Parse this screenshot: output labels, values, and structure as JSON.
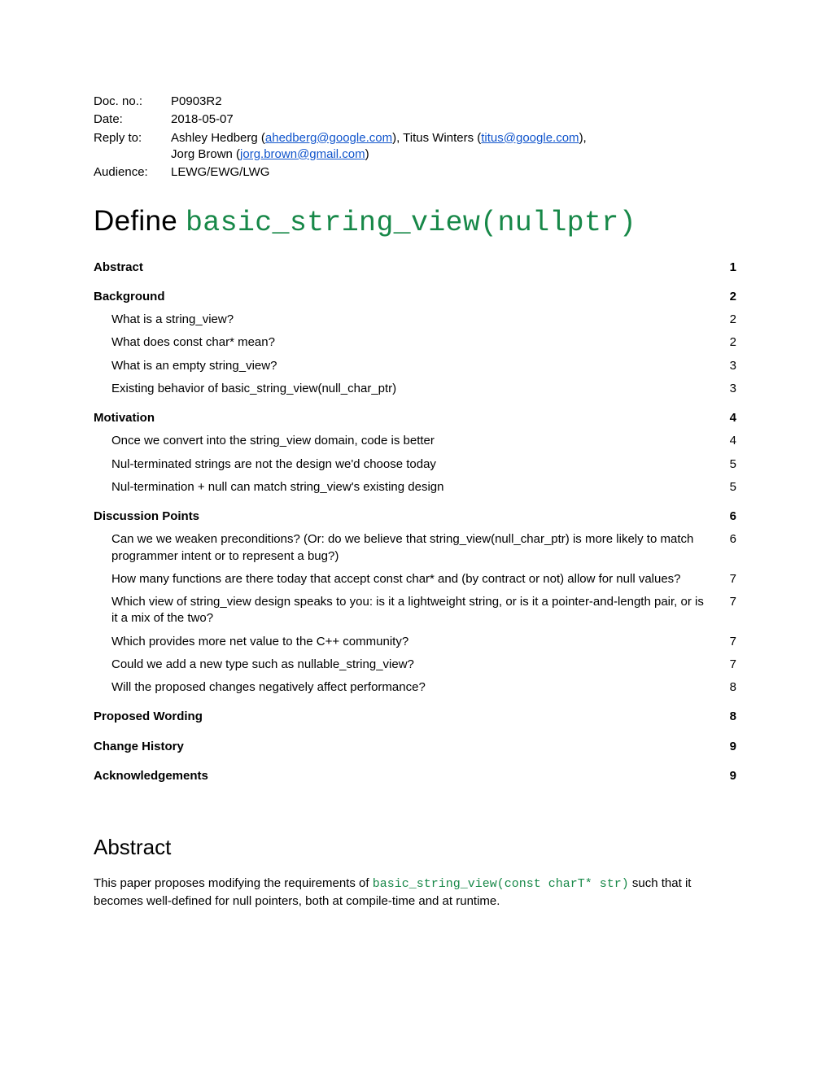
{
  "meta": {
    "docno_label": "Doc. no.:",
    "docno_value": "P0903R2",
    "date_label": "Date:",
    "date_value": "2018-05-07",
    "replyto_label": "Reply to:",
    "replyto_prefix1": "Ashley Hedberg (",
    "replyto_email1": "ahedberg@google.com",
    "replyto_mid1": "), Titus Winters (",
    "replyto_email2": "titus@google.com",
    "replyto_suffix1": "),",
    "replyto_prefix2": "Jorg Brown (",
    "replyto_email3": "jorg.brown@gmail.com",
    "replyto_suffix2": ")",
    "audience_label": "Audience:",
    "audience_value": "LEWG/EWG/LWG"
  },
  "title": {
    "plain": "Define ",
    "code": "basic_string_view(nullptr)"
  },
  "toc": {
    "abstract": {
      "label": "Abstract",
      "page": "1"
    },
    "background": {
      "label": "Background",
      "page": "2"
    },
    "bg1": {
      "label": "What is a string_view?",
      "page": "2"
    },
    "bg2": {
      "label": "What does const char* mean?",
      "page": "2"
    },
    "bg3": {
      "label": "What is an empty string_view?",
      "page": "3"
    },
    "bg4": {
      "label": "Existing behavior of basic_string_view(null_char_ptr)",
      "page": "3"
    },
    "motivation": {
      "label": "Motivation",
      "page": "4"
    },
    "mo1": {
      "label": "Once we convert into the string_view domain, code is better",
      "page": "4"
    },
    "mo2": {
      "label": "Nul-terminated strings are not the design we'd choose today",
      "page": "5"
    },
    "mo3": {
      "label": "Nul-termination + null can match string_view's existing design",
      "page": "5"
    },
    "discussion": {
      "label": "Discussion Points",
      "page": "6"
    },
    "dp1": {
      "label": "Can we we weaken preconditions? (Or: do we believe that string_view(null_char_ptr) is more likely to match programmer intent or to represent a bug?)",
      "page": "6"
    },
    "dp2": {
      "label": "How many functions are there today that accept const char* and (by contract or not) allow for null values?",
      "page": "7"
    },
    "dp3": {
      "label": "Which view of string_view design speaks to you: is it a lightweight string, or is it a pointer-and-length pair, or is it a mix of the two?",
      "page": "7"
    },
    "dp4": {
      "label": "Which provides more net value to the C++ community?",
      "page": "7"
    },
    "dp5": {
      "label": "Could we add a new type such as nullable_string_view?",
      "page": "7"
    },
    "dp6": {
      "label": "Will the proposed changes negatively affect performance?",
      "page": "8"
    },
    "proposed": {
      "label": "Proposed Wording",
      "page": "8"
    },
    "history": {
      "label": "Change History",
      "page": "9"
    },
    "ack": {
      "label": "Acknowledgements",
      "page": "9"
    }
  },
  "abstract": {
    "heading": "Abstract",
    "text_pre": "This paper proposes modifying the requirements of ",
    "text_code": "basic_string_view(const charT* str)",
    "text_post": " such that it becomes well-defined for null pointers, both at compile-time and at runtime."
  }
}
